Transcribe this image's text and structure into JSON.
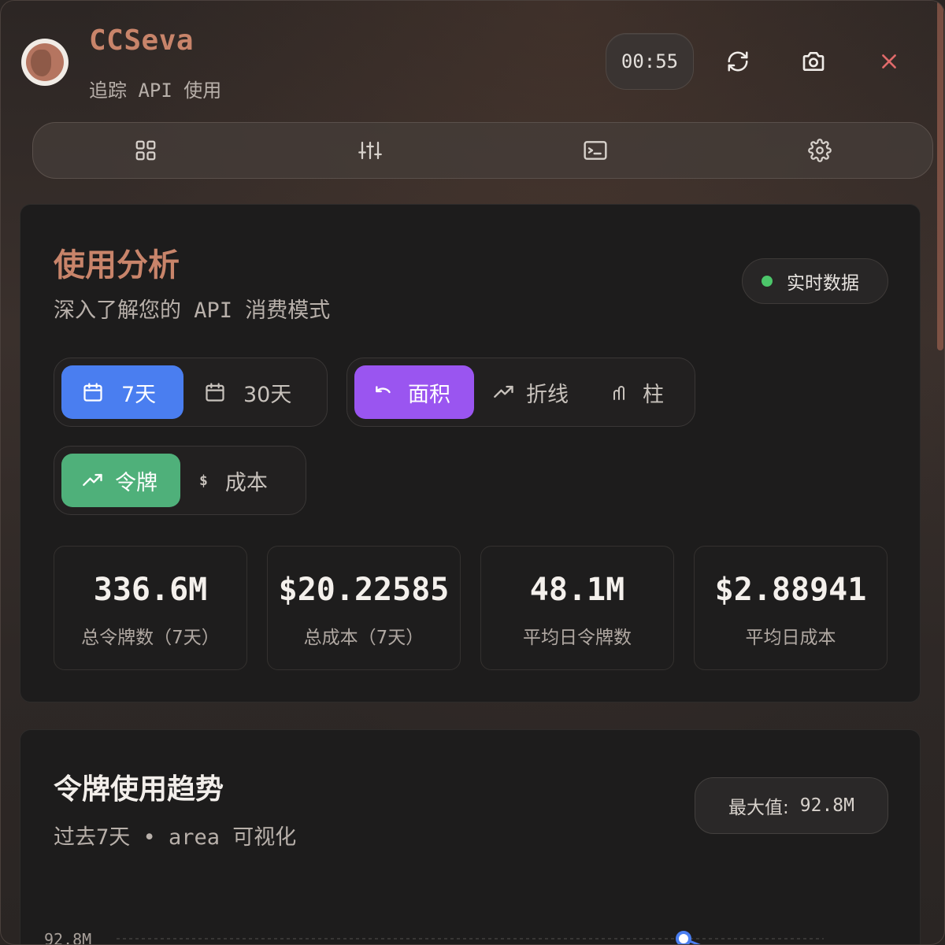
{
  "app": {
    "title": "CCSeva",
    "subtitle": "追踪 API 使用",
    "timer": "00:55"
  },
  "header_icons": [
    "refresh-icon",
    "camera-icon",
    "close-icon"
  ],
  "nav": {
    "items": [
      "dashboard-grid-icon",
      "sliders-icon",
      "terminal-icon",
      "gear-icon"
    ]
  },
  "analytics": {
    "title": "使用分析",
    "subtitle": "深入了解您的 API 消费模式",
    "live_badge": "实时数据",
    "range": [
      {
        "label": "7天",
        "active": true
      },
      {
        "label": "30天",
        "active": false
      }
    ],
    "chart_types": [
      {
        "label": "面积",
        "icon": "undo-area-icon",
        "active": true
      },
      {
        "label": "折线",
        "icon": "trending-icon",
        "active": false
      },
      {
        "label": "柱",
        "icon": "bar-icon",
        "active": false
      }
    ],
    "metrics": [
      {
        "label": "令牌",
        "icon": "trending-icon",
        "active": true
      },
      {
        "label": "成本",
        "icon": "dollar-icon",
        "active": false
      }
    ],
    "dollar_symbol": "$",
    "stats": [
      {
        "value": "336.6M",
        "label": "总令牌数（7天）"
      },
      {
        "value": "$20.22585",
        "label": "总成本（7天）"
      },
      {
        "value": "48.1M",
        "label": "平均日令牌数"
      },
      {
        "value": "$2.88941",
        "label": "平均日成本"
      }
    ]
  },
  "trend": {
    "title": "令牌使用趋势",
    "subtitle": "过去7天 • area 可视化",
    "max_label": "最大值:",
    "max_value": "92.8M",
    "y_tick": "92.8M"
  },
  "colors": {
    "accent": "#c8846a",
    "blue": "#4a7ef0",
    "purple": "#9a55f0",
    "green": "#4fb07a",
    "live": "#4cc66a",
    "close": "#e06a6a"
  }
}
